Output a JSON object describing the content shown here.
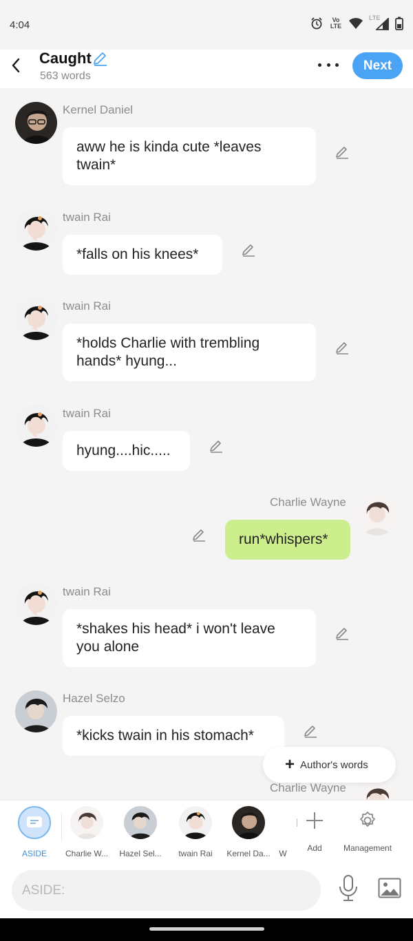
{
  "status_bar": {
    "time": "4:04",
    "volte_label": "Vo LTE",
    "lte_label": "LTE"
  },
  "header": {
    "title": "Caught",
    "word_count": "563 words",
    "next_label": "Next"
  },
  "messages": [
    {
      "sender": "Kernel Daniel",
      "text": "aww he is kinda cute *leaves twain*"
    },
    {
      "sender": "twain Rai",
      "text": "*falls on his knees*"
    },
    {
      "sender": "twain Rai",
      "text": "*holds Charlie with trembling hands* hyung..."
    },
    {
      "sender": "twain Rai",
      "text": "hyung....hic....."
    },
    {
      "sender": "Charlie Wayne",
      "text": "run*whispers*"
    },
    {
      "sender": "twain Rai",
      "text": "*shakes his head* i won't leave you alone"
    },
    {
      "sender": "Hazel Selzo",
      "text": "*kicks twain in his stomach*"
    },
    {
      "sender": "Charlie Wayne",
      "text": ""
    }
  ],
  "author_popup": {
    "label": "Author's words"
  },
  "character_bar": {
    "items": [
      {
        "label": "ASIDE"
      },
      {
        "label": "Charlie W..."
      },
      {
        "label": "Hazel Sel..."
      },
      {
        "label": "twain Rai"
      },
      {
        "label": "Kernel Da..."
      },
      {
        "label": "W"
      }
    ],
    "add_label": "Add",
    "management_label": "Management"
  },
  "input": {
    "placeholder": "ASIDE:",
    "value": ""
  },
  "colors": {
    "accent": "#4aa3f5",
    "my_bubble": "#cdee8c",
    "bubble": "#ffffff",
    "background": "#f4f4f4"
  }
}
